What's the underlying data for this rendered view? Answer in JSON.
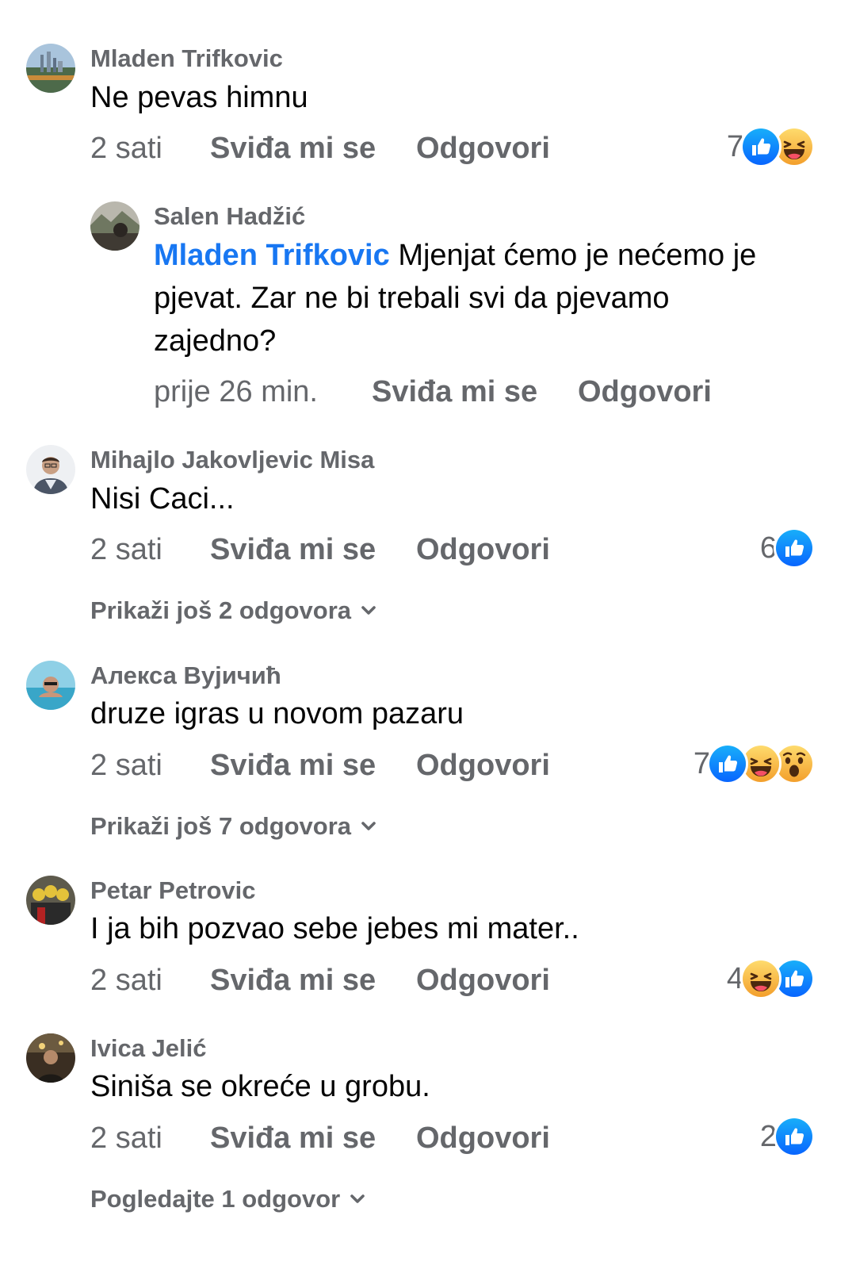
{
  "comments": [
    {
      "author": "Mladen Trifkovic",
      "text": "Ne pevas himnu",
      "time": "2 sati",
      "like_label": "Sviđa mi se",
      "reply_label": "Odgovori",
      "reaction_count": "7",
      "reactions": [
        "like-icon",
        "haha-icon"
      ]
    },
    {
      "author": "Salen Hadžić",
      "mention": "Mladen Trifkovic",
      "text_line1": "Mjenjat ćemo je nećemo je",
      "text_line2": "pjevat. Zar ne bi trebali svi da pjevamo",
      "text_line3": "zajedno?",
      "time": "prije 26 min.",
      "like_label": "Sviđa mi se",
      "reply_label": "Odgovori"
    },
    {
      "author": "Mihajlo Jakovljevic Misa",
      "text": "Nisi Caci...",
      "time": "2 sati",
      "like_label": "Sviđa mi se",
      "reply_label": "Odgovori",
      "reaction_count": "6",
      "reactions": [
        "like-icon"
      ],
      "more_replies": "Prikaži još 2 odgovora"
    },
    {
      "author": "Алекса Вујичић",
      "text": "druze igras u novom pazaru",
      "time": "2 sati",
      "like_label": "Sviđa mi se",
      "reply_label": "Odgovori",
      "reaction_count": "7",
      "reactions": [
        "like-icon",
        "haha-icon",
        "wow-icon"
      ],
      "more_replies": "Prikaži još 7 odgovora"
    },
    {
      "author": "Petar Petrovic",
      "text": "I ja bih pozvao sebe jebes mi mater..",
      "time": "2 sati",
      "like_label": "Sviđa mi se",
      "reply_label": "Odgovori",
      "reaction_count": "4",
      "reactions": [
        "haha-icon",
        "like-icon"
      ]
    },
    {
      "author": "Ivica Jelić",
      "text": "Siniša se okreće u grobu.",
      "time": "2 sati",
      "like_label": "Sviđa mi se",
      "reply_label": "Odgovori",
      "reaction_count": "2",
      "reactions": [
        "like-icon"
      ],
      "more_replies": "Pogledajte 1 odgovor"
    }
  ],
  "colors": {
    "meta_gray": "#65676b",
    "text_black": "#050505",
    "mention_blue": "#1877f2",
    "like_blue": "#1877f2",
    "haha_yellow": "#f7b125"
  }
}
